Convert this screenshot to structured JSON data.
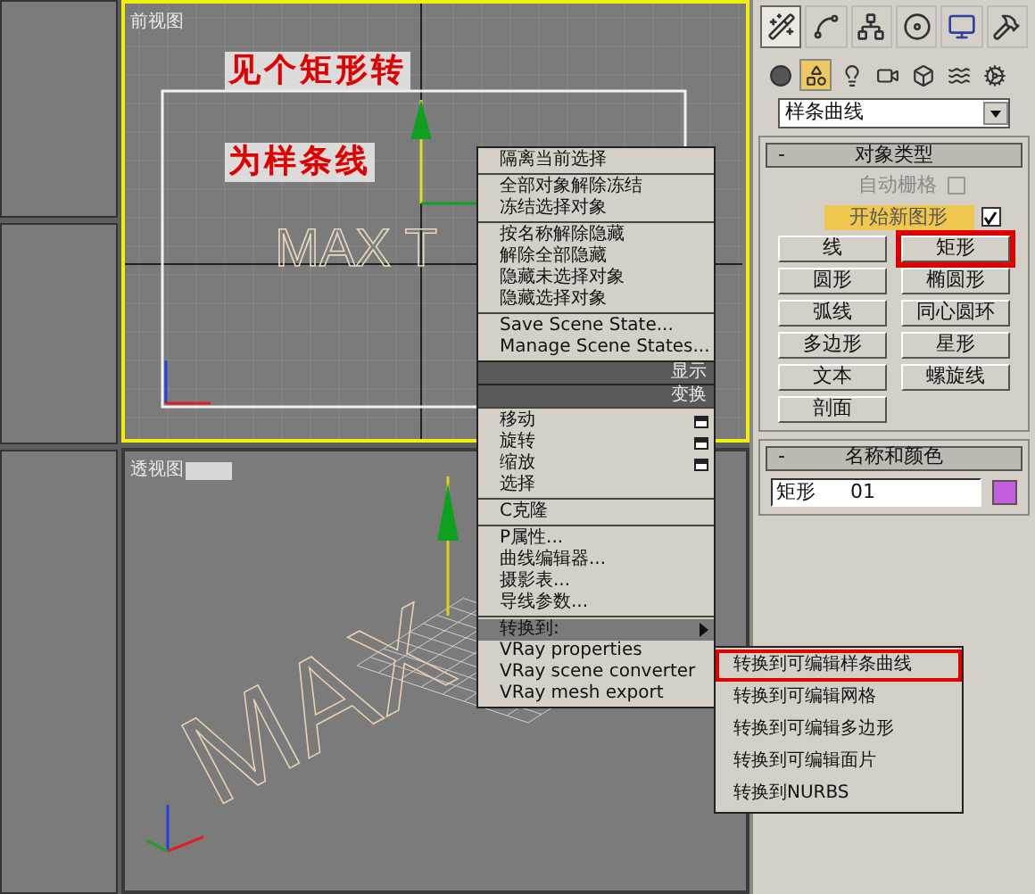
{
  "viewports": {
    "front": {
      "label": "前视图",
      "active": true,
      "object_text": "MAX T",
      "annotation_lines": [
        "见个矩形转",
        "为样条线"
      ]
    },
    "perspective": {
      "label": "透视图",
      "object_text": "MAX"
    }
  },
  "context_menu": {
    "sections": [
      {
        "kind": "group",
        "items": [
          {
            "label": "隔离当前选择",
            "selected": false,
            "options": false,
            "submenu": false
          }
        ]
      },
      {
        "kind": "group",
        "items": [
          {
            "label": "全部对象解除冻结",
            "selected": false,
            "options": false,
            "submenu": false
          },
          {
            "label": "冻结选择对象",
            "selected": false,
            "options": false,
            "submenu": false
          }
        ]
      },
      {
        "kind": "group",
        "items": [
          {
            "label": "按名称解除隐藏",
            "selected": false,
            "options": false,
            "submenu": false
          },
          {
            "label": "解除全部隐藏",
            "selected": false,
            "options": false,
            "submenu": false
          },
          {
            "label": "隐藏未选择对象",
            "selected": false,
            "options": false,
            "submenu": false
          },
          {
            "label": "隐藏选择对象",
            "selected": false,
            "options": false,
            "submenu": false
          }
        ]
      },
      {
        "kind": "group",
        "items": [
          {
            "label": "Save Scene State...",
            "selected": false,
            "options": false,
            "submenu": false
          },
          {
            "label": "Manage Scene States...",
            "selected": false,
            "options": false,
            "submenu": false
          }
        ]
      },
      {
        "kind": "header",
        "label": "显示"
      },
      {
        "kind": "header",
        "label": "变换"
      },
      {
        "kind": "group",
        "items": [
          {
            "label": "移动",
            "selected": false,
            "options": true,
            "submenu": false
          },
          {
            "label": "旋转",
            "selected": false,
            "options": true,
            "submenu": false
          },
          {
            "label": "缩放",
            "selected": false,
            "options": true,
            "submenu": false
          },
          {
            "label": "选择",
            "selected": false,
            "options": false,
            "submenu": false
          }
        ]
      },
      {
        "kind": "group",
        "items": [
          {
            "label": "C克隆",
            "selected": false,
            "options": false,
            "submenu": false
          }
        ]
      },
      {
        "kind": "group",
        "items": [
          {
            "label": "P属性...",
            "selected": false,
            "options": false,
            "submenu": false
          },
          {
            "label": "曲线编辑器...",
            "selected": false,
            "options": false,
            "submenu": false
          },
          {
            "label": "摄影表...",
            "selected": false,
            "options": false,
            "submenu": false
          },
          {
            "label": "导线参数...",
            "selected": false,
            "options": false,
            "submenu": false
          }
        ]
      },
      {
        "kind": "group",
        "items": [
          {
            "label": "转换到:",
            "selected": true,
            "options": false,
            "submenu": true
          },
          {
            "label": "VRay properties",
            "selected": false,
            "options": false,
            "submenu": false
          },
          {
            "label": "VRay scene converter",
            "selected": false,
            "options": false,
            "submenu": false
          },
          {
            "label": "VRay mesh export",
            "selected": false,
            "options": false,
            "submenu": false
          }
        ]
      }
    ]
  },
  "submenu": {
    "items": [
      {
        "label": "转换到可编辑样条曲线",
        "marked": true
      },
      {
        "label": "转换到可编辑网格",
        "marked": false
      },
      {
        "label": "转换到可编辑多边形",
        "marked": false
      },
      {
        "label": "转换到可编辑面片",
        "marked": false
      },
      {
        "label": "转换到NURBS",
        "marked": false
      }
    ]
  },
  "command_panel": {
    "tabs": [
      {
        "selected": true
      },
      {
        "selected": false
      },
      {
        "selected": false
      },
      {
        "selected": false
      },
      {
        "selected": false
      },
      {
        "selected": false
      }
    ],
    "categories": [
      {
        "selected": false
      },
      {
        "selected": true
      },
      {
        "selected": false
      },
      {
        "selected": false
      },
      {
        "selected": false
      },
      {
        "selected": false
      },
      {
        "selected": false
      }
    ],
    "dropdown": {
      "value": "样条曲线"
    },
    "object_type": {
      "title": "对象类型",
      "collapse": "-",
      "autogrid": {
        "label": "自动栅格",
        "checked": false,
        "disabled": true
      },
      "start_new": {
        "label": "开始新图形",
        "checked": true
      },
      "buttons": [
        {
          "label": "线",
          "marked": false
        },
        {
          "label": "矩形",
          "marked": true
        },
        {
          "label": "圆形",
          "marked": false
        },
        {
          "label": "椭圆形",
          "marked": false
        },
        {
          "label": "弧线",
          "marked": false
        },
        {
          "label": "同心圆环",
          "marked": false
        },
        {
          "label": "多边形",
          "marked": false
        },
        {
          "label": "星形",
          "marked": false
        },
        {
          "label": "文本",
          "marked": false
        },
        {
          "label": "螺旋线",
          "marked": false
        },
        {
          "label": "剖面",
          "marked": false
        }
      ]
    },
    "name_color": {
      "title": "名称和颜色",
      "collapse": "-",
      "name": "矩形 01",
      "color": "#c45ee0"
    }
  }
}
